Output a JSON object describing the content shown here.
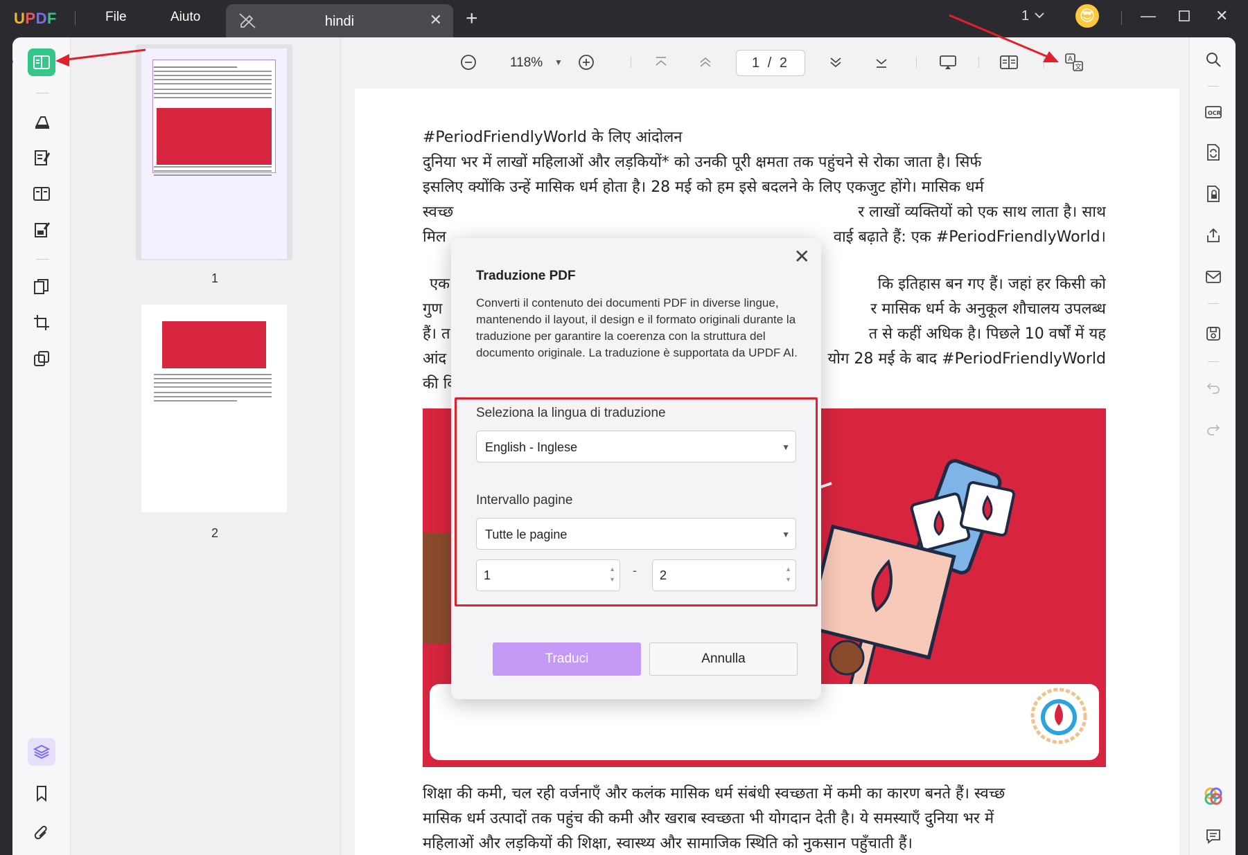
{
  "titlebar": {
    "logo": [
      "U",
      "P",
      "D",
      "F"
    ],
    "menu": [
      "File",
      "Aiuto"
    ],
    "tab_title": "hindi",
    "page_count": "1",
    "avatar_emoji": "😎"
  },
  "toolbar": {
    "zoom": "118%",
    "page_indicator": "1 / 2"
  },
  "thumbnails": [
    {
      "label": "1"
    },
    {
      "label": "2"
    }
  ],
  "document": {
    "lines": [
      "#PeriodFriendlyWorld के लिए आंदोलन",
      "दुनिया भर में लाखों महिलाओं और लड़कियों* को उनकी पूरी क्षमता तक पहुंचने से रोका जाता है। सिर्फ",
      "इसलिए क्योंकि उन्हें मासिक धर्म होता है। 28 मई को हम इसे बदलने के लिए एकजुट होंगे। मासिक धर्म",
      "स्वच्छ",
      "मिल",
      "एक",
      "गुण",
      "हैं। त",
      "आंद",
      "की वि"
    ],
    "lines_right": [
      "र लाखों व्यक्तियों को एक साथ लाता है। साथ",
      "वाई बढ़ाते हैं: एक #PeriodFriendlyWorld।",
      "कि इतिहास बन गए हैं। जहां हर किसी को",
      "र मासिक धर्म के अनुकूल शौचालय उपलब्ध",
      "त से कहीं अधिक है। पिछले 10 वर्षों में यह",
      "योग 28 मई के बाद #PeriodFriendlyWorld"
    ],
    "bottom_lines": [
      "शिक्षा की कमी, चल रही वर्जनाएँ और कलंक मासिक धर्म संबंधी स्वच्छता में कमी का कारण बनते हैं। स्वच्छ",
      "मासिक धर्म उत्पादों तक पहुंच की कमी और खराब स्वच्छता भी योगदान देती है। ये समस्याएँ दुनिया भर में",
      "महिलाओं और लड़कियों की शिक्षा, स्वास्थ्य और सामाजिक स्थिति को नुकसान पहुँचाती हैं।"
    ]
  },
  "dialog": {
    "title": "Traduzione PDF",
    "description": "Converti il contenuto dei documenti PDF in diverse lingue, mantenendo il layout, il design e il formato originali durante la traduzione per garantire la coerenza con la struttura del documento originale. La traduzione è supportata da UPDF AI.",
    "language_label": "Seleziona la lingua di traduzione",
    "language_value": "English - Inglese",
    "range_label": "Intervallo pagine",
    "range_value": "Tutte le pagine",
    "range_from": "1",
    "range_to": "2",
    "range_dash": "-",
    "translate_button": "Traduci",
    "cancel_button": "Annulla"
  },
  "colors": {
    "accent_green": "#35c68a",
    "accent_purple": "#c49af6",
    "highlight_red": "#e0202a",
    "banner_red": "#d8253f"
  }
}
